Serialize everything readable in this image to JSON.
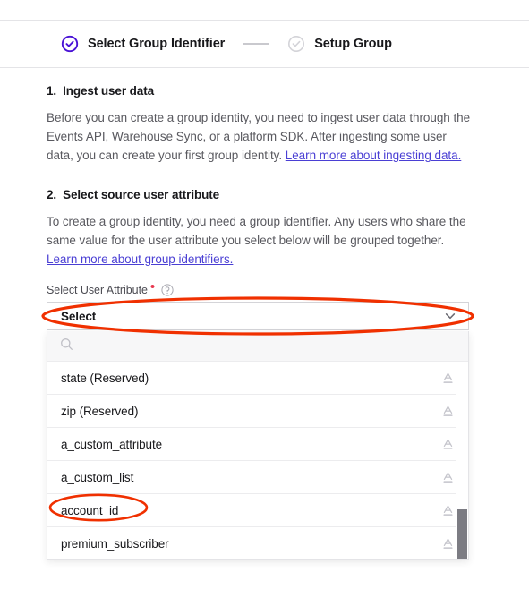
{
  "stepper": {
    "steps": [
      {
        "label": "Select Group Identifier",
        "state": "active",
        "icon": "check-circle-icon"
      },
      {
        "label": "Setup Group",
        "state": "inactive",
        "icon": "check-circle-icon"
      }
    ]
  },
  "sections": {
    "one": {
      "number": "1.",
      "title": "Ingest user data",
      "body": "Before you can create a group identity, you need to ingest user data through the Events API, Warehouse Sync, or a platform SDK. After ingesting some user data, you can create your first group identity. ",
      "link": "Learn more about ingesting data."
    },
    "two": {
      "number": "2.",
      "title": "Select source user attribute",
      "body": "To create a group identity, you need a group identifier. Any users who share the same value for the user attribute you select below will be grouped together. ",
      "link": "Learn more about group identifiers."
    }
  },
  "field": {
    "label": "Select User Attribute",
    "required_marker": "•",
    "help_icon": "question-circle-icon",
    "select_value": "Select",
    "chevron_icon": "chevron-down-icon"
  },
  "dropdown": {
    "search_placeholder": "",
    "search_value": "",
    "search_icon": "search-icon",
    "items": [
      {
        "label": "state (Reserved)",
        "type_icon": "text-type-icon"
      },
      {
        "label": "zip (Reserved)",
        "type_icon": "text-type-icon"
      },
      {
        "label": "a_custom_attribute",
        "type_icon": "text-type-icon"
      },
      {
        "label": "a_custom_list",
        "type_icon": "text-type-icon"
      },
      {
        "label": "account_id",
        "type_icon": "text-type-icon"
      },
      {
        "label": "premium_subscriber",
        "type_icon": "text-type-icon"
      }
    ]
  },
  "colors": {
    "accent_purple": "#4a3fd4",
    "step_active": "#4a13d6",
    "step_inactive": "#c9c9ce",
    "link": "#4a3fd4",
    "annotation_red": "#f03000",
    "required_red": "#e8384f",
    "body_text": "#59595f",
    "scrollbar_thumb": "#7c7c83"
  }
}
